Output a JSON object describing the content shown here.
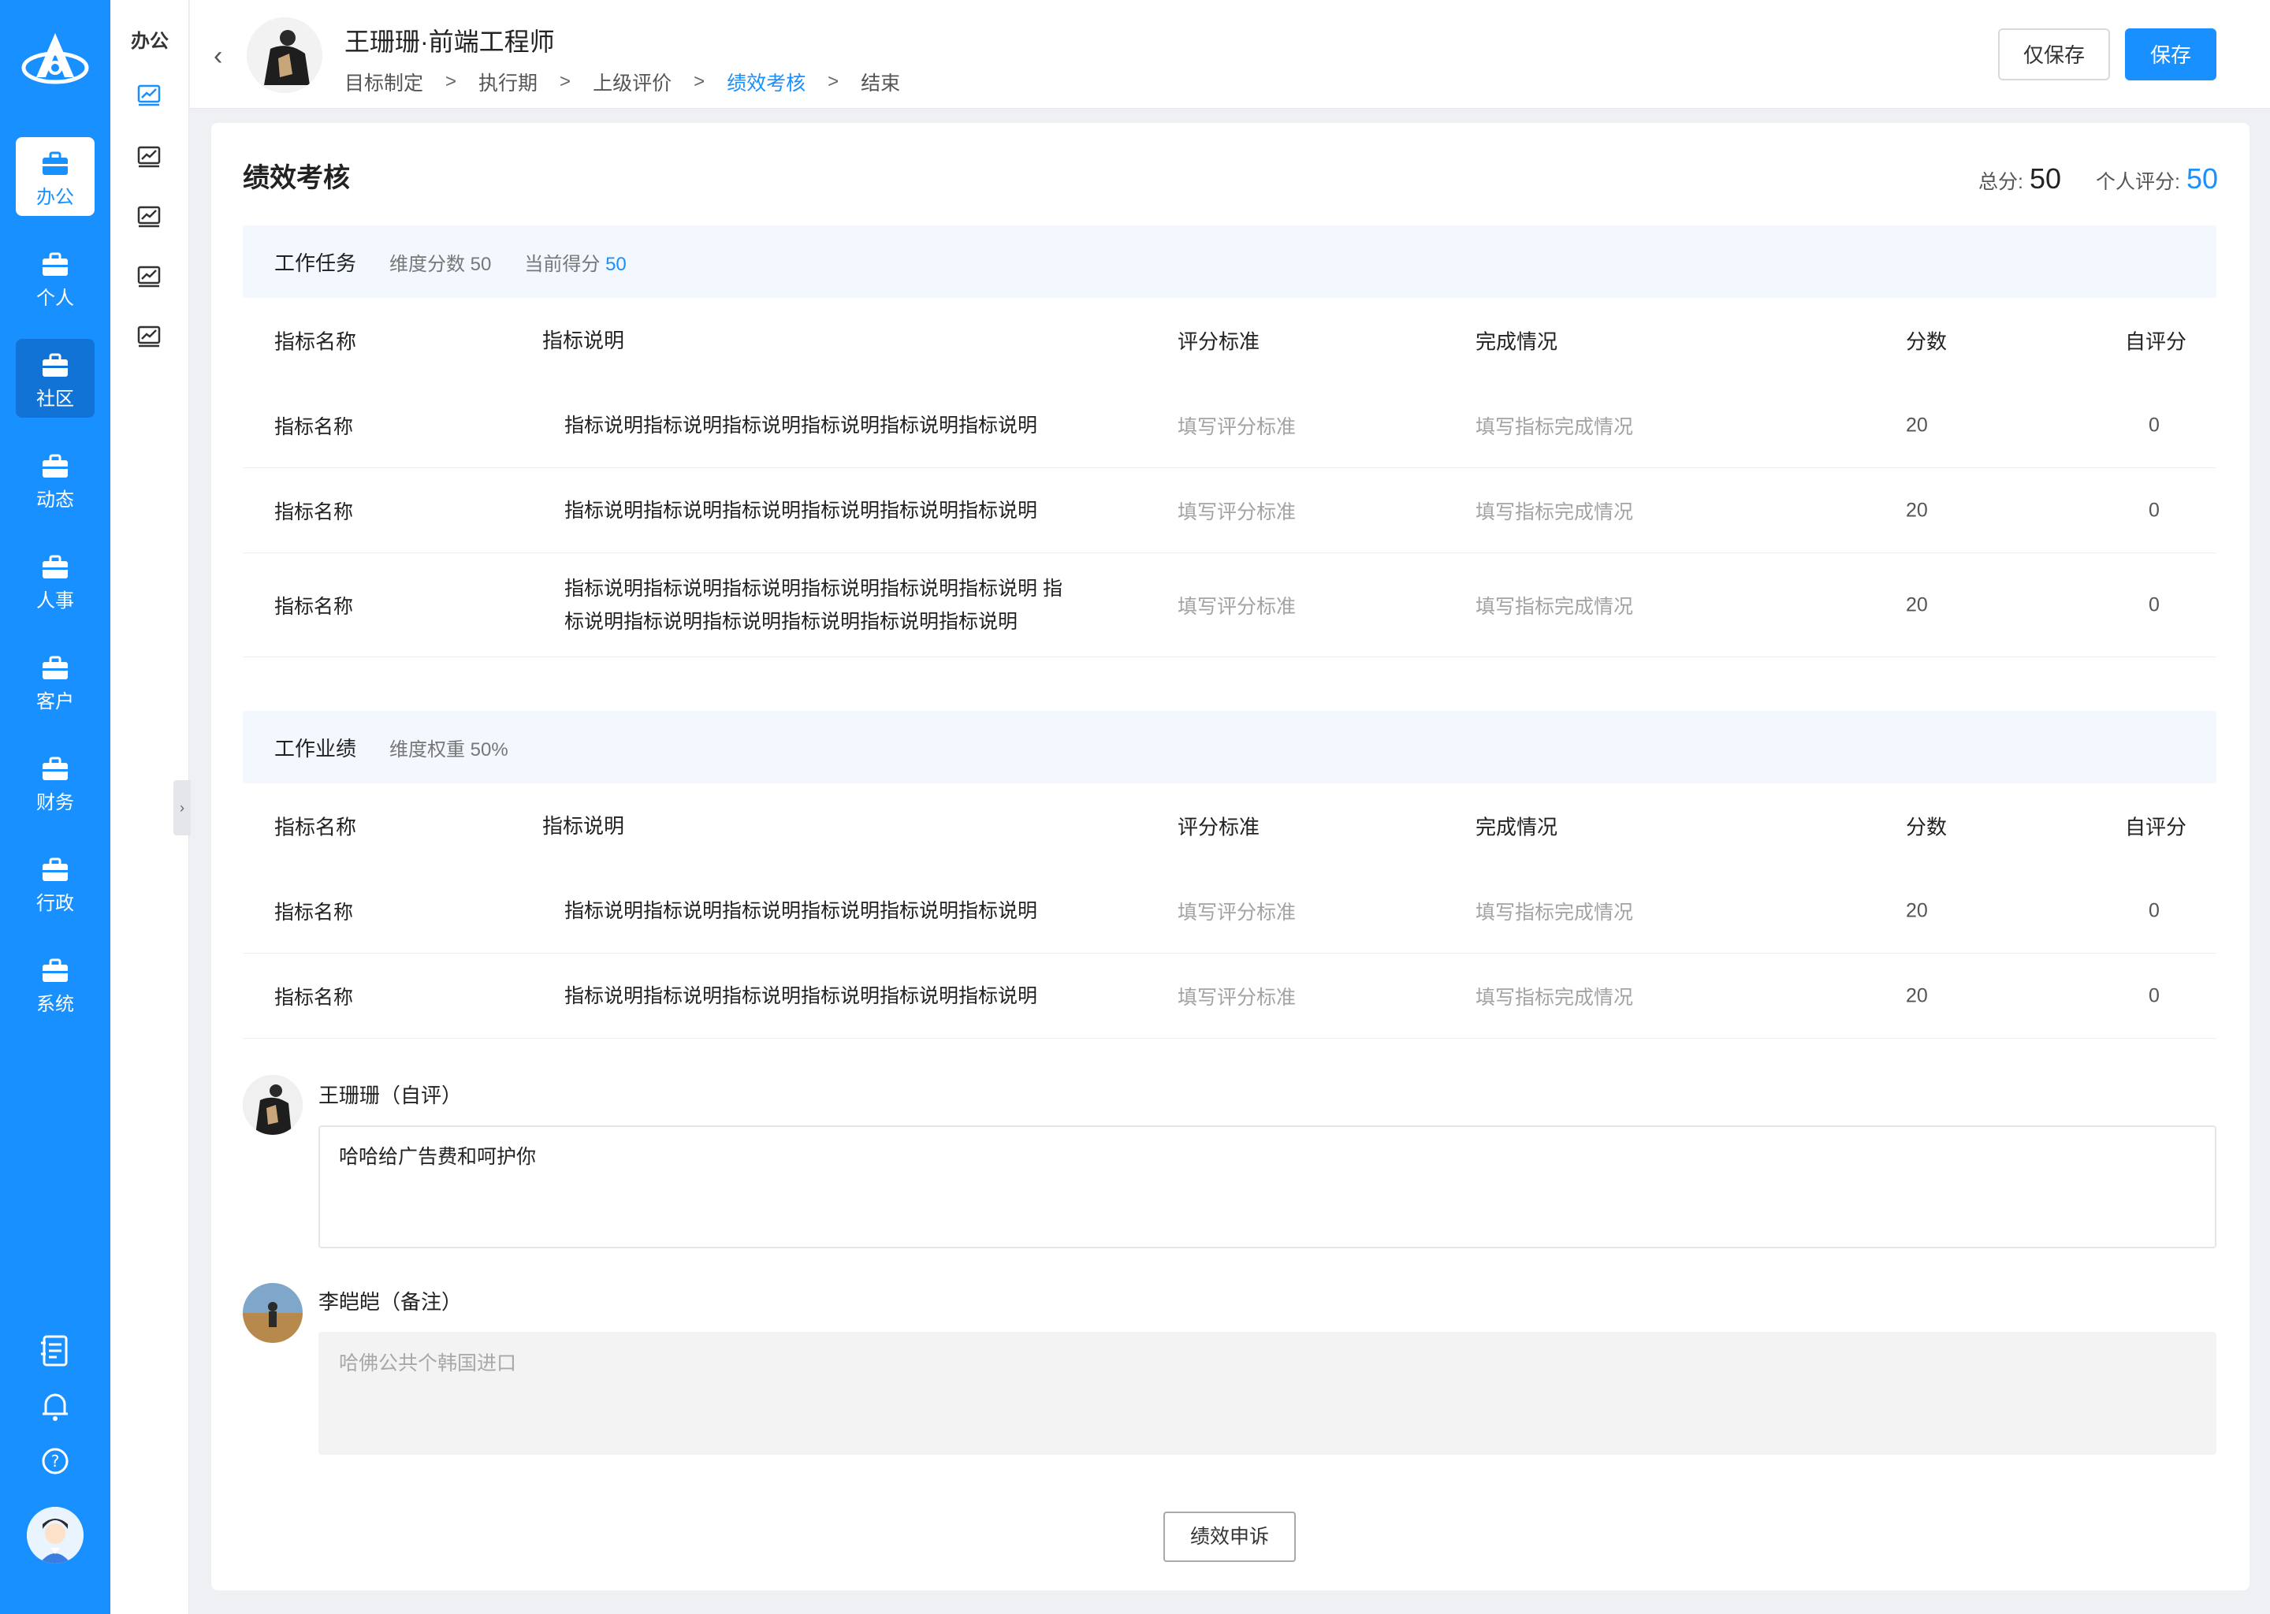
{
  "rail": {
    "items": [
      {
        "label": "办公",
        "state": "active"
      },
      {
        "label": "个人",
        "state": "normal"
      },
      {
        "label": "社区",
        "state": "hover"
      },
      {
        "label": "动态",
        "state": "normal"
      },
      {
        "label": "人事",
        "state": "normal"
      },
      {
        "label": "客户",
        "state": "normal"
      },
      {
        "label": "财务",
        "state": "normal"
      },
      {
        "label": "行政",
        "state": "normal"
      },
      {
        "label": "系统",
        "state": "normal"
      }
    ],
    "bottom_icons": [
      "notebook-icon",
      "bell-icon",
      "help-icon"
    ]
  },
  "subnav": {
    "title": "办公",
    "icons": [
      "chart-icon",
      "chart-icon",
      "chart-icon",
      "chart-icon",
      "chart-icon"
    ]
  },
  "header": {
    "title": "王珊珊·前端工程师",
    "steps": [
      "目标制定",
      "执行期",
      "上级评价",
      "绩效考核",
      "结束"
    ],
    "active_step": "绩效考核",
    "save_only_label": "仅保存",
    "save_label": "保存"
  },
  "page": {
    "title": "绩效考核",
    "total_label": "总分:",
    "total_value": "50",
    "self_label": "个人评分:",
    "self_value": "50"
  },
  "columns": [
    "指标名称",
    "指标说明",
    "评分标准",
    "完成情况",
    "分数",
    "自评分"
  ],
  "sections": [
    {
      "title": "工作任务",
      "meta1": "维度分数 50",
      "meta2_label": "当前得分",
      "meta2_value": "50",
      "rows": [
        {
          "name": "指标名称",
          "desc": "指标说明指标说明指标说明指标说明指标说明指标说明",
          "std": "填写评分标准",
          "done": "填写指标完成情况",
          "score": "20",
          "self": "0"
        },
        {
          "name": "指标名称",
          "desc": "指标说明指标说明指标说明指标说明指标说明指标说明",
          "std": "填写评分标准",
          "done": "填写指标完成情况",
          "score": "20",
          "self": "0"
        },
        {
          "name": "指标名称",
          "desc": "指标说明指标说明指标说明指标说明指标说明指标说明 指标说明指标说明指标说明指标说明指标说明指标说明",
          "std": "填写评分标准",
          "done": "填写指标完成情况",
          "score": "20",
          "self": "0"
        }
      ]
    },
    {
      "title": "工作业绩",
      "meta1": "维度权重 50%",
      "rows": [
        {
          "name": "指标名称",
          "desc": "指标说明指标说明指标说明指标说明指标说明指标说明",
          "std": "填写评分标准",
          "done": "填写指标完成情况",
          "score": "20",
          "self": "0"
        },
        {
          "name": "指标名称",
          "desc": "指标说明指标说明指标说明指标说明指标说明指标说明",
          "std": "填写评分标准",
          "done": "填写指标完成情况",
          "score": "20",
          "self": "0"
        }
      ]
    }
  ],
  "comments": [
    {
      "name": "王珊珊（自评）",
      "text": "哈哈给广告费和呵护你",
      "editable": true
    },
    {
      "name": "李皑皑（备注）",
      "text": "哈佛公共个韩国进口",
      "editable": false
    }
  ],
  "appeal_label": "绩效申诉",
  "colors": {
    "accent": "#1890ff",
    "rail": "#1890ff",
    "section_bg": "#f3f8ff"
  }
}
